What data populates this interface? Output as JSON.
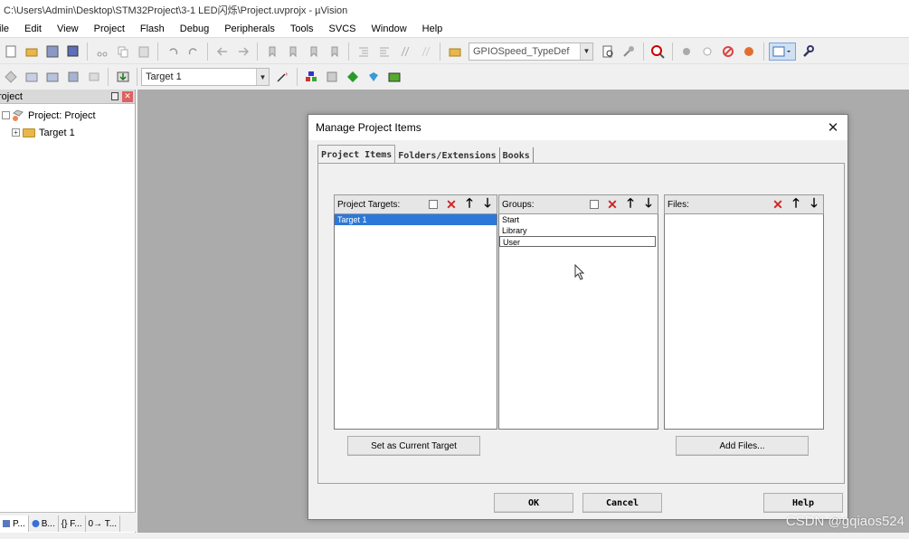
{
  "window": {
    "title": "C:\\Users\\Admin\\Desktop\\STM32Project\\3-1 LED闪烁\\Project.uvprojx - µVision"
  },
  "menu": [
    "ile",
    "Edit",
    "View",
    "Project",
    "Flash",
    "Debug",
    "Peripherals",
    "Tools",
    "SVCS",
    "Window",
    "Help"
  ],
  "toolbar": {
    "find_combo_value": "GPIOSpeed_TypeDef",
    "target_combo_value": "Target 1"
  },
  "project_panel": {
    "title": "roject",
    "tree": [
      {
        "label": "Project: Project",
        "expander": ""
      },
      {
        "label": "Target 1",
        "expander": "+"
      }
    ],
    "tabs": [
      "P...",
      "B...",
      "{} F...",
      "0→ T..."
    ]
  },
  "dialog": {
    "title": "Manage Project Items",
    "close_glyph": "✕",
    "tabs": [
      "Project Items",
      "Folders/Extensions",
      "Books"
    ],
    "targets": {
      "label": "Project Targets:",
      "items": [
        "Target 1"
      ],
      "selected": 0
    },
    "groups": {
      "label": "Groups:",
      "items": [
        "Start",
        "Library",
        "User"
      ]
    },
    "files": {
      "label": "Files:",
      "items": []
    },
    "set_current_target_label": "Set as Current Target",
    "add_files_label": "Add Files...",
    "ok_label": "OK",
    "cancel_label": "Cancel",
    "help_label": "Help"
  },
  "watermark": "CSDN @gqiaos524",
  "colors": {
    "selection": "#2c78d8",
    "editor_background": "#ababab",
    "delete_icon": "#d42424"
  }
}
